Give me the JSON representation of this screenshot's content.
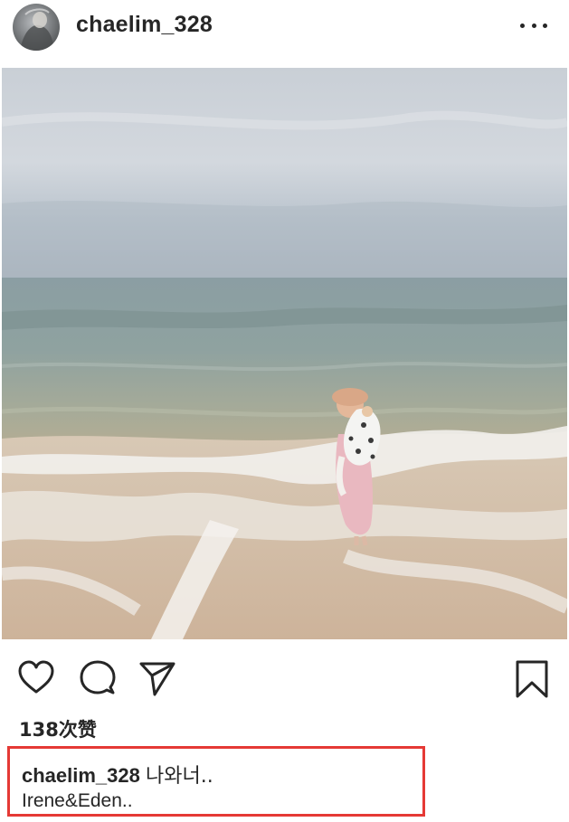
{
  "post": {
    "username": "chaelim_328",
    "likes": "138次赞",
    "caption": {
      "username": "chaelim_328",
      "text": "나와너..",
      "line2": "Irene&Eden.."
    }
  },
  "icons": {
    "more": "more-options-icon",
    "like": "heart-icon",
    "comment": "comment-icon",
    "share": "send-icon",
    "save": "bookmark-icon"
  },
  "colors": {
    "text": "#262626",
    "highlight_border": "#e53935",
    "background": "#ffffff"
  }
}
